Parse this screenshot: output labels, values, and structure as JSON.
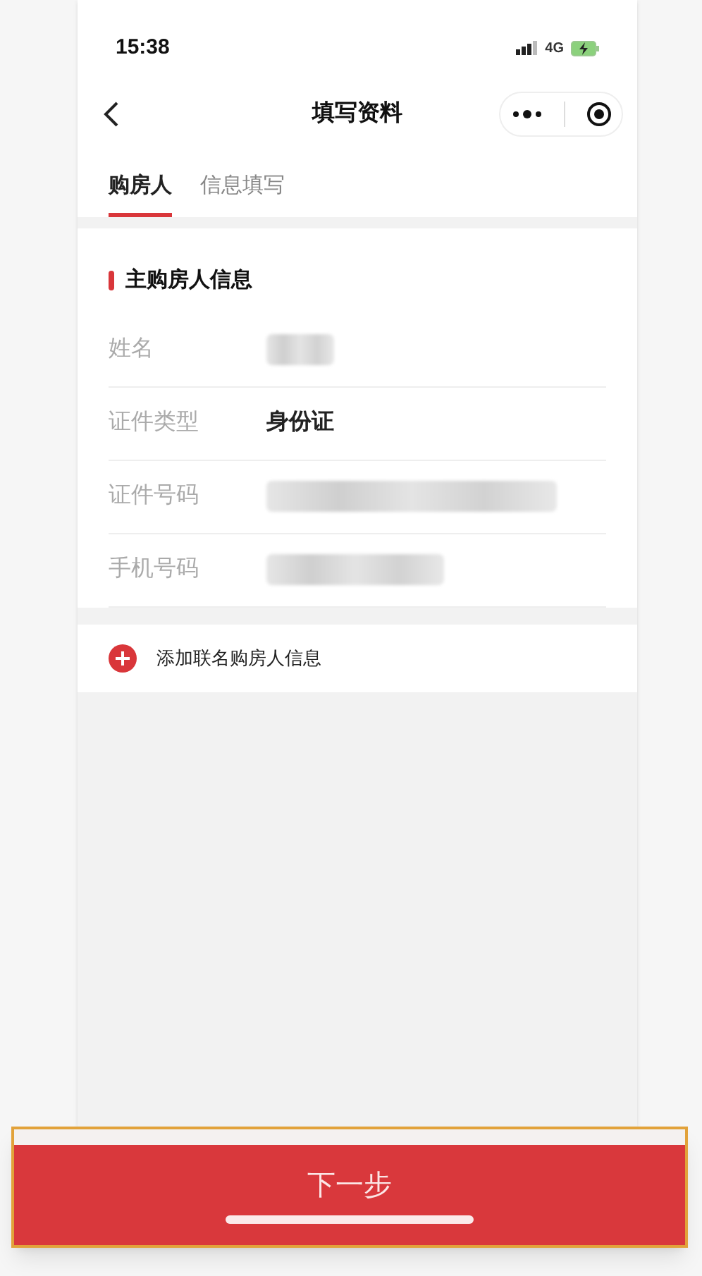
{
  "status_bar": {
    "time": "15:38",
    "network": "4G"
  },
  "nav": {
    "title": "填写资料"
  },
  "tabs": [
    {
      "label": "购房人",
      "selected": true
    },
    {
      "label": "信息填写",
      "selected": false
    }
  ],
  "section": {
    "title": "主购房人信息"
  },
  "fields": [
    {
      "label": "姓名",
      "kind": "redacted"
    },
    {
      "label": "证件类型",
      "kind": "text",
      "value": "身份证"
    },
    {
      "label": "证件号码",
      "kind": "redacted"
    },
    {
      "label": "手机号码",
      "kind": "redacted"
    }
  ],
  "add_action": {
    "label": "添加联名购房人信息"
  },
  "next_button": {
    "label": "下一步"
  }
}
